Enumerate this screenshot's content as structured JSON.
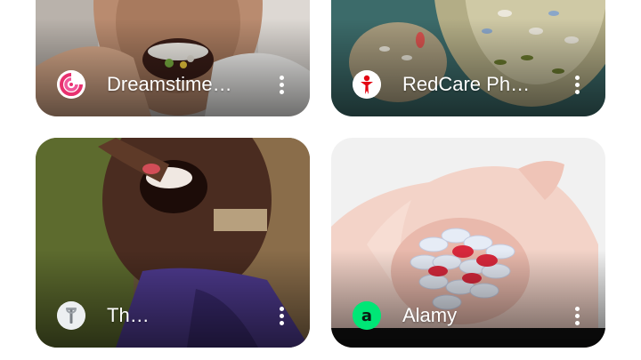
{
  "results": [
    {
      "source": "Dreamstime.com",
      "icon": "dreamstime-logo-icon",
      "accent": "#e8316f"
    },
    {
      "source": "RedCare Pharmacy",
      "icon": "redcare-logo-icon",
      "accent": "#e30613"
    },
    {
      "source": "The Conversation",
      "icon": "the-conversation-logo-icon",
      "accent": "#9aa0a6"
    },
    {
      "source": "Alamy",
      "icon": "alamy-logo-icon",
      "accent": "#00e676"
    }
  ],
  "menu_icon": "more-vert-icon"
}
